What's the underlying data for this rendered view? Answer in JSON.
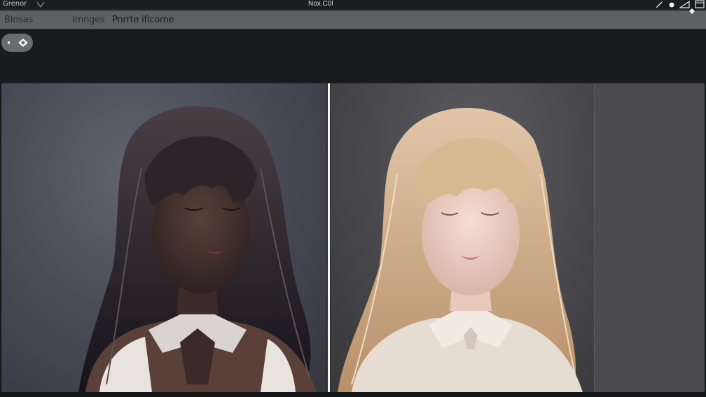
{
  "titlebar": {
    "app_name": "Grenor",
    "window_title": "Nox.C0l"
  },
  "toolbar": {
    "items": [
      {
        "label": "Blnsas"
      },
      {
        "label": "Imnges"
      },
      {
        "label": "Pnrrte iflcome"
      }
    ]
  },
  "icons": {
    "app_menu": "chevron-down-icon",
    "pen": "pen-icon",
    "dot": "record-dot-icon",
    "ruler": "ruler-icon",
    "window": "window-icon",
    "toggle": "eye-icon",
    "corner": "diamond-icon"
  },
  "viewer": {
    "left_image": "portrait of a woman with long dark hair, eyes closed, brown knit vest and lace collar",
    "right_image": "portrait of a woman with long blonde hair, eyes closed, cream knit top with lace collar"
  }
}
